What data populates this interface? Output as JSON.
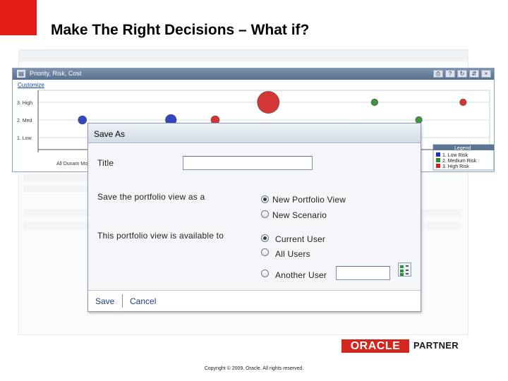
{
  "slide": {
    "title": "Make The Right Decisions – What if?",
    "copyright": "Copyright © 2009, Oracle. All rights reserved.",
    "logo_text": "ORACLE",
    "logo_badge": "PARTNER"
  },
  "portlet": {
    "title": "Priority, Risk, Cost",
    "customize_label": "Customize",
    "buttons": [
      "print-icon",
      "help-icon",
      "refresh-icon",
      "collapse-icon",
      "close-icon"
    ]
  },
  "chart_data": {
    "type": "scatter",
    "y_categories": [
      "1. Low",
      "2. Med",
      "3. High"
    ],
    "x_visible_label": "All Dunam Mo",
    "legend_title": "Legend",
    "legend": [
      {
        "name": "1. Low Risk",
        "color": "#2233bb"
      },
      {
        "name": "2. Medium Risk",
        "color": "#2a8a2a"
      },
      {
        "name": "3. High Risk",
        "color": "#d02020"
      }
    ],
    "points": [
      {
        "x": 1,
        "y": "2. Med",
        "size": 1,
        "risk": "1. Low Risk"
      },
      {
        "x": 3,
        "y": "2. Med",
        "size": 1.3,
        "risk": "1. Low Risk"
      },
      {
        "x": 4,
        "y": "2. Med",
        "size": 1,
        "risk": "3. High Risk"
      },
      {
        "x": 5.2,
        "y": "3. High",
        "size": 2.6,
        "risk": "3. High Risk"
      },
      {
        "x": 7.6,
        "y": "3. High",
        "size": 0.8,
        "risk": "2. Medium Risk"
      },
      {
        "x": 8.6,
        "y": "2. Med",
        "size": 0.8,
        "risk": "2. Medium Risk"
      },
      {
        "x": 9.6,
        "y": "3. High",
        "size": 0.8,
        "risk": "3. High Risk"
      }
    ],
    "colors": {
      "low": "#2233bb",
      "medium": "#2a8a2a",
      "high": "#d02020"
    }
  },
  "dialog": {
    "title": "Save As",
    "title_label": "Title",
    "title_value": "",
    "save_view_label": "Save the portfolio view as a",
    "save_view_options": [
      "New Portfolio View",
      "New Scenario"
    ],
    "save_view_selected": "New Portfolio View",
    "available_label": "This portfolio view is available to",
    "available_options": [
      "Current User",
      "All Users",
      "Another User"
    ],
    "available_selected": "Current User",
    "another_user_value": "",
    "save_button": "Save",
    "cancel_button": "Cancel"
  }
}
